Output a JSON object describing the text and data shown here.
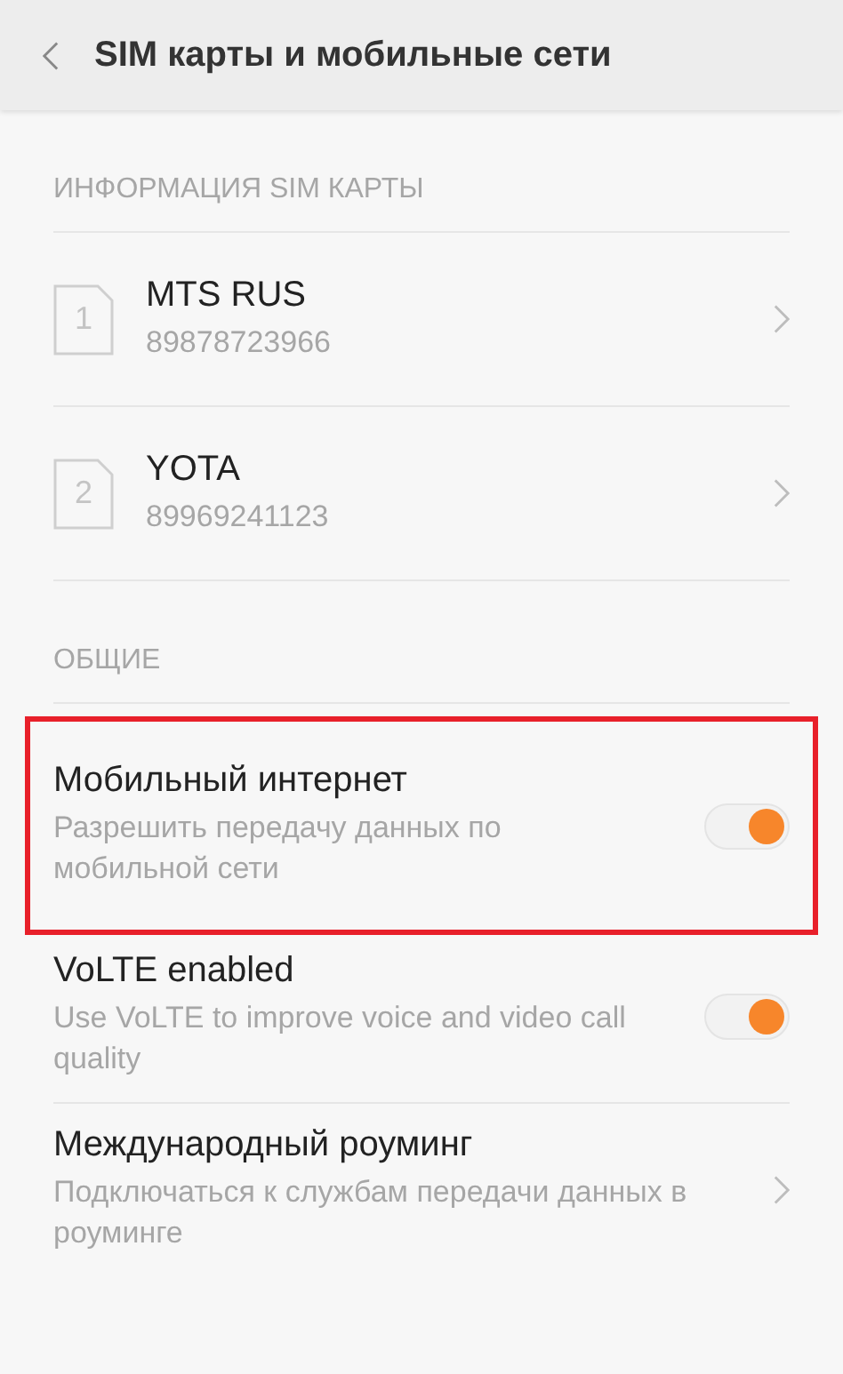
{
  "header": {
    "title": "SIM карты и мобильные сети"
  },
  "sections": [
    {
      "title": "ИНФОРМАЦИЯ SIM КАРТЫ",
      "items": [
        {
          "kind": "sim",
          "slot": "1",
          "title": "MTS RUS",
          "subtitle": "89878723966"
        },
        {
          "kind": "sim",
          "slot": "2",
          "title": "YOTA",
          "subtitle": "89969241123"
        }
      ]
    },
    {
      "title": "ОБЩИЕ",
      "items": [
        {
          "kind": "toggle",
          "title": "Мобильный интернет",
          "subtitle": "Разрешить передачу данных по мобильной сети",
          "on": true,
          "highlighted": true
        },
        {
          "kind": "toggle",
          "title": "VoLTE enabled",
          "subtitle": "Use VoLTE to improve voice and video call quality",
          "on": true,
          "highlighted": false
        },
        {
          "kind": "link",
          "title": "Международный роуминг",
          "subtitle": "Подключаться к службам передачи данных в роуминге"
        }
      ]
    }
  ]
}
